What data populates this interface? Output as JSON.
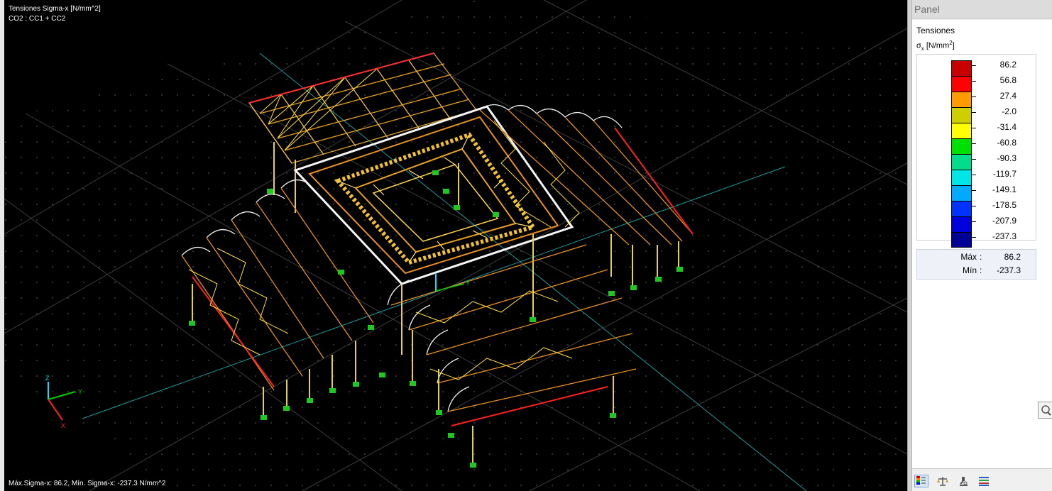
{
  "viewport": {
    "title": "Tensiones Sigma-x [N/mm^2]",
    "combination": "CO2 : CC1 + CC2",
    "status": "Máx.Sigma-x: 86.2, Mín. Sigma-x: -237.3 N/mm^2",
    "axes": {
      "x": "X",
      "y": "Y",
      "z": "Z"
    }
  },
  "panel": {
    "title": "Panel",
    "section": "Tensiones",
    "unit_symbol": "σ",
    "unit_sub": "x",
    "unit_text": "[N/mm",
    "unit_sup": "2",
    "unit_close": "]",
    "legend": [
      {
        "value": "86.2",
        "color": "#c80000"
      },
      {
        "value": "56.8",
        "color": "#ff0000"
      },
      {
        "value": "27.4",
        "color": "#ff9a00"
      },
      {
        "value": "-2.0",
        "color": "#cfcf00"
      },
      {
        "value": "-31.4",
        "color": "#ffff00"
      },
      {
        "value": "-60.8",
        "color": "#00e000"
      },
      {
        "value": "-90.3",
        "color": "#00dc8c"
      },
      {
        "value": "-119.7",
        "color": "#00e6e6"
      },
      {
        "value": "-149.1",
        "color": "#00aaff"
      },
      {
        "value": "-178.5",
        "color": "#0033ff"
      },
      {
        "value": "-207.9",
        "color": "#0000dc"
      },
      {
        "value": "-237.3",
        "color": "#000096"
      }
    ],
    "max_label": "Máx",
    "max_value": "86.2",
    "min_label": "Mín",
    "min_value": "-237.3",
    "separator": ":",
    "footer_buttons": [
      "color-scale-icon",
      "balance-icon",
      "microscope-icon",
      "lines-list-icon"
    ]
  }
}
